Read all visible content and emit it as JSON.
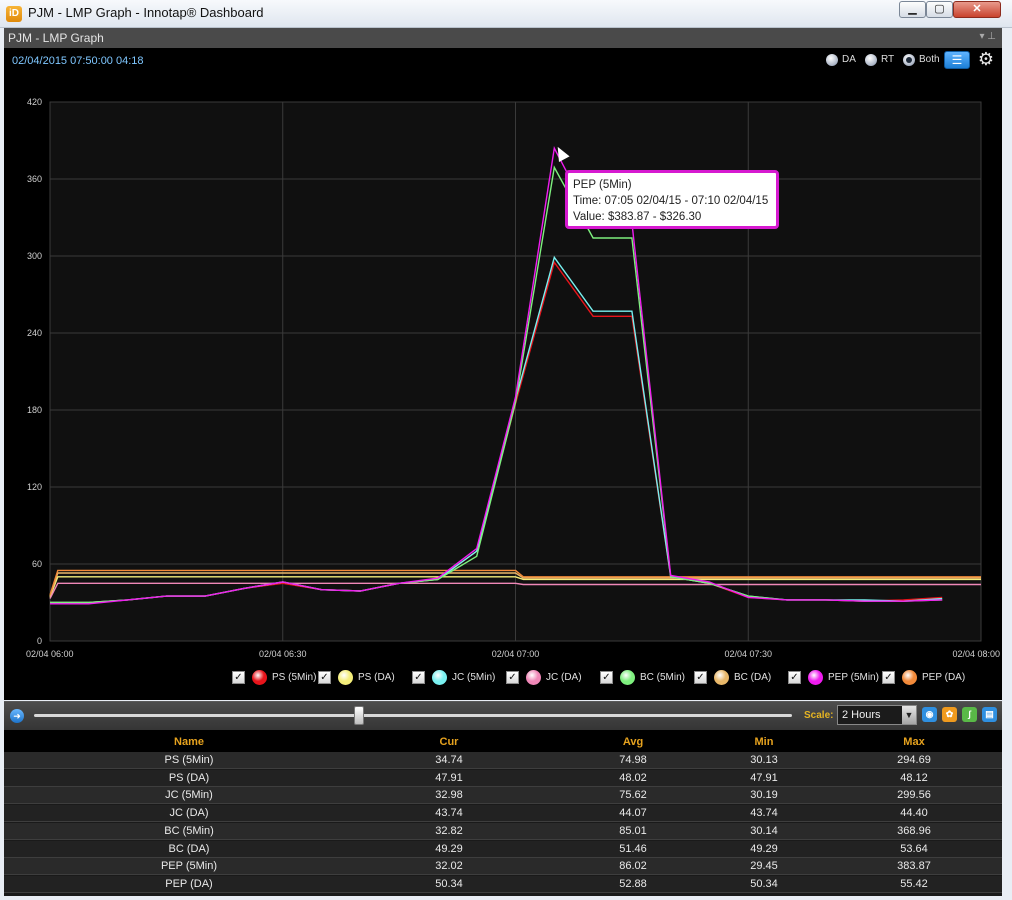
{
  "window": {
    "title": "PJM - LMP Graph - Innotap® Dashboard",
    "app_icon": "innotap-app-icon",
    "controls": [
      "minimize-icon",
      "maximize-icon",
      "close-icon"
    ]
  },
  "panel": {
    "title": "PJM - LMP Graph",
    "timestamp": "02/04/2015 07:50:00  04:18",
    "modes": [
      {
        "label": "DA",
        "selected": false
      },
      {
        "label": "RT",
        "selected": false
      },
      {
        "label": "Both",
        "selected": true
      }
    ]
  },
  "legend": [
    {
      "label": "PS (5Min)",
      "color": "#e8141b",
      "checked": true
    },
    {
      "label": "PS (DA)",
      "color": "#f4ee7a",
      "checked": true
    },
    {
      "label": "JC (5Min)",
      "color": "#79f0f0",
      "checked": true
    },
    {
      "label": "JC (DA)",
      "color": "#f088b8",
      "checked": true
    },
    {
      "label": "BC (5Min)",
      "color": "#7ef07e",
      "checked": true
    },
    {
      "label": "BC (DA)",
      "color": "#e9b86a",
      "checked": true
    },
    {
      "label": "PEP (5Min)",
      "color": "#f01cf0",
      "checked": true
    },
    {
      "label": "PEP (DA)",
      "color": "#f28a3a",
      "checked": true
    }
  ],
  "tooltip": {
    "line1": "PEP (5Min)",
    "line2": "Time: 07:05 02/04/15 - 07:10 02/04/15",
    "line3": "Value: $383.87 - $326.30"
  },
  "controls": {
    "scale_label": "Scale:",
    "scale_value": "2 Hours"
  },
  "table": {
    "headers": [
      "Name",
      "Cur",
      "Avg",
      "Min",
      "Max"
    ],
    "rows": [
      [
        "PS (5Min)",
        "34.74",
        "74.98",
        "30.13",
        "294.69"
      ],
      [
        "PS (DA)",
        "47.91",
        "48.02",
        "47.91",
        "48.12"
      ],
      [
        "JC (5Min)",
        "32.98",
        "75.62",
        "30.19",
        "299.56"
      ],
      [
        "JC (DA)",
        "43.74",
        "44.07",
        "43.74",
        "44.40"
      ],
      [
        "BC (5Min)",
        "32.82",
        "85.01",
        "30.14",
        "368.96"
      ],
      [
        "BC (DA)",
        "49.29",
        "51.46",
        "49.29",
        "53.64"
      ],
      [
        "PEP (5Min)",
        "32.02",
        "86.02",
        "29.45",
        "383.87"
      ],
      [
        "PEP (DA)",
        "50.34",
        "52.88",
        "50.34",
        "55.42"
      ]
    ]
  },
  "chart_data": {
    "type": "line",
    "ylim": [
      0,
      420
    ],
    "yticks": [
      "0",
      "60",
      "120",
      "180",
      "240",
      "300",
      "360",
      "420"
    ],
    "xlim": [
      0,
      120
    ],
    "xticks": [
      {
        "min": 0,
        "label": "02/04 06:00"
      },
      {
        "min": 30,
        "label": "02/04 06:30"
      },
      {
        "min": 60,
        "label": "02/04 07:00"
      },
      {
        "min": 90,
        "label": "02/04 07:30"
      },
      {
        "min": 120,
        "label": "02/04 08:00"
      }
    ],
    "grid": true,
    "series": [
      {
        "name": "PS (DA)",
        "color": "#f4ee7a",
        "x": [
          0,
          1,
          60,
          61,
          120
        ],
        "y": [
          34,
          50,
          50,
          48,
          48
        ]
      },
      {
        "name": "JC (DA)",
        "color": "#f088b8",
        "x": [
          0,
          1,
          60,
          61,
          120
        ],
        "y": [
          33,
          45,
          45,
          44,
          44
        ]
      },
      {
        "name": "BC (DA)",
        "color": "#e9b86a",
        "x": [
          0,
          1,
          60,
          61,
          120
        ],
        "y": [
          35,
          53,
          53,
          49,
          49
        ]
      },
      {
        "name": "PEP (DA)",
        "color": "#f28a3a",
        "x": [
          0,
          1,
          60,
          61,
          120
        ],
        "y": [
          36,
          55,
          55,
          50,
          50
        ]
      },
      {
        "name": "PS (5Min)",
        "color": "#e8141b",
        "x": [
          0,
          5,
          10,
          15,
          20,
          25,
          30,
          35,
          40,
          45,
          50,
          55,
          60,
          65,
          70,
          75,
          80,
          85,
          90,
          95,
          100,
          105,
          110,
          115
        ],
        "y": [
          30,
          30,
          32,
          35,
          35,
          41,
          45,
          40,
          39,
          45,
          48,
          70,
          185,
          295,
          253,
          253,
          50,
          45,
          34,
          32,
          32,
          31,
          32,
          34
        ]
      },
      {
        "name": "JC (5Min)",
        "color": "#79f0f0",
        "x": [
          0,
          5,
          10,
          15,
          20,
          25,
          30,
          35,
          40,
          45,
          50,
          55,
          60,
          65,
          70,
          75,
          80,
          85,
          90,
          95,
          100,
          105,
          110,
          115
        ],
        "y": [
          30,
          30,
          32,
          35,
          35,
          41,
          46,
          40,
          39,
          45,
          48,
          70,
          188,
          299,
          257,
          257,
          50,
          45,
          35,
          32,
          32,
          32,
          31,
          33
        ]
      },
      {
        "name": "BC (5Min)",
        "color": "#7ef07e",
        "x": [
          0,
          5,
          10,
          15,
          20,
          25,
          30,
          35,
          40,
          45,
          50,
          55,
          60,
          65,
          70,
          75,
          80,
          85,
          90,
          95,
          100,
          105,
          110,
          115
        ],
        "y": [
          30,
          30,
          32,
          35,
          35,
          41,
          46,
          40,
          39,
          45,
          48,
          66,
          186,
          369,
          314,
          314,
          50,
          45,
          35,
          32,
          32,
          31,
          31,
          32
        ]
      },
      {
        "name": "PEP (5Min)",
        "color": "#f01cf0",
        "x": [
          0,
          5,
          10,
          15,
          20,
          25,
          30,
          35,
          40,
          45,
          50,
          55,
          60,
          65,
          70,
          75,
          80,
          85,
          90,
          95,
          100,
          105,
          110,
          115
        ],
        "y": [
          29,
          29,
          32,
          35,
          35,
          41,
          46,
          40,
          39,
          45,
          49,
          72,
          190,
          384,
          326,
          326,
          51,
          46,
          34,
          32,
          32,
          31,
          31,
          32
        ]
      }
    ]
  }
}
